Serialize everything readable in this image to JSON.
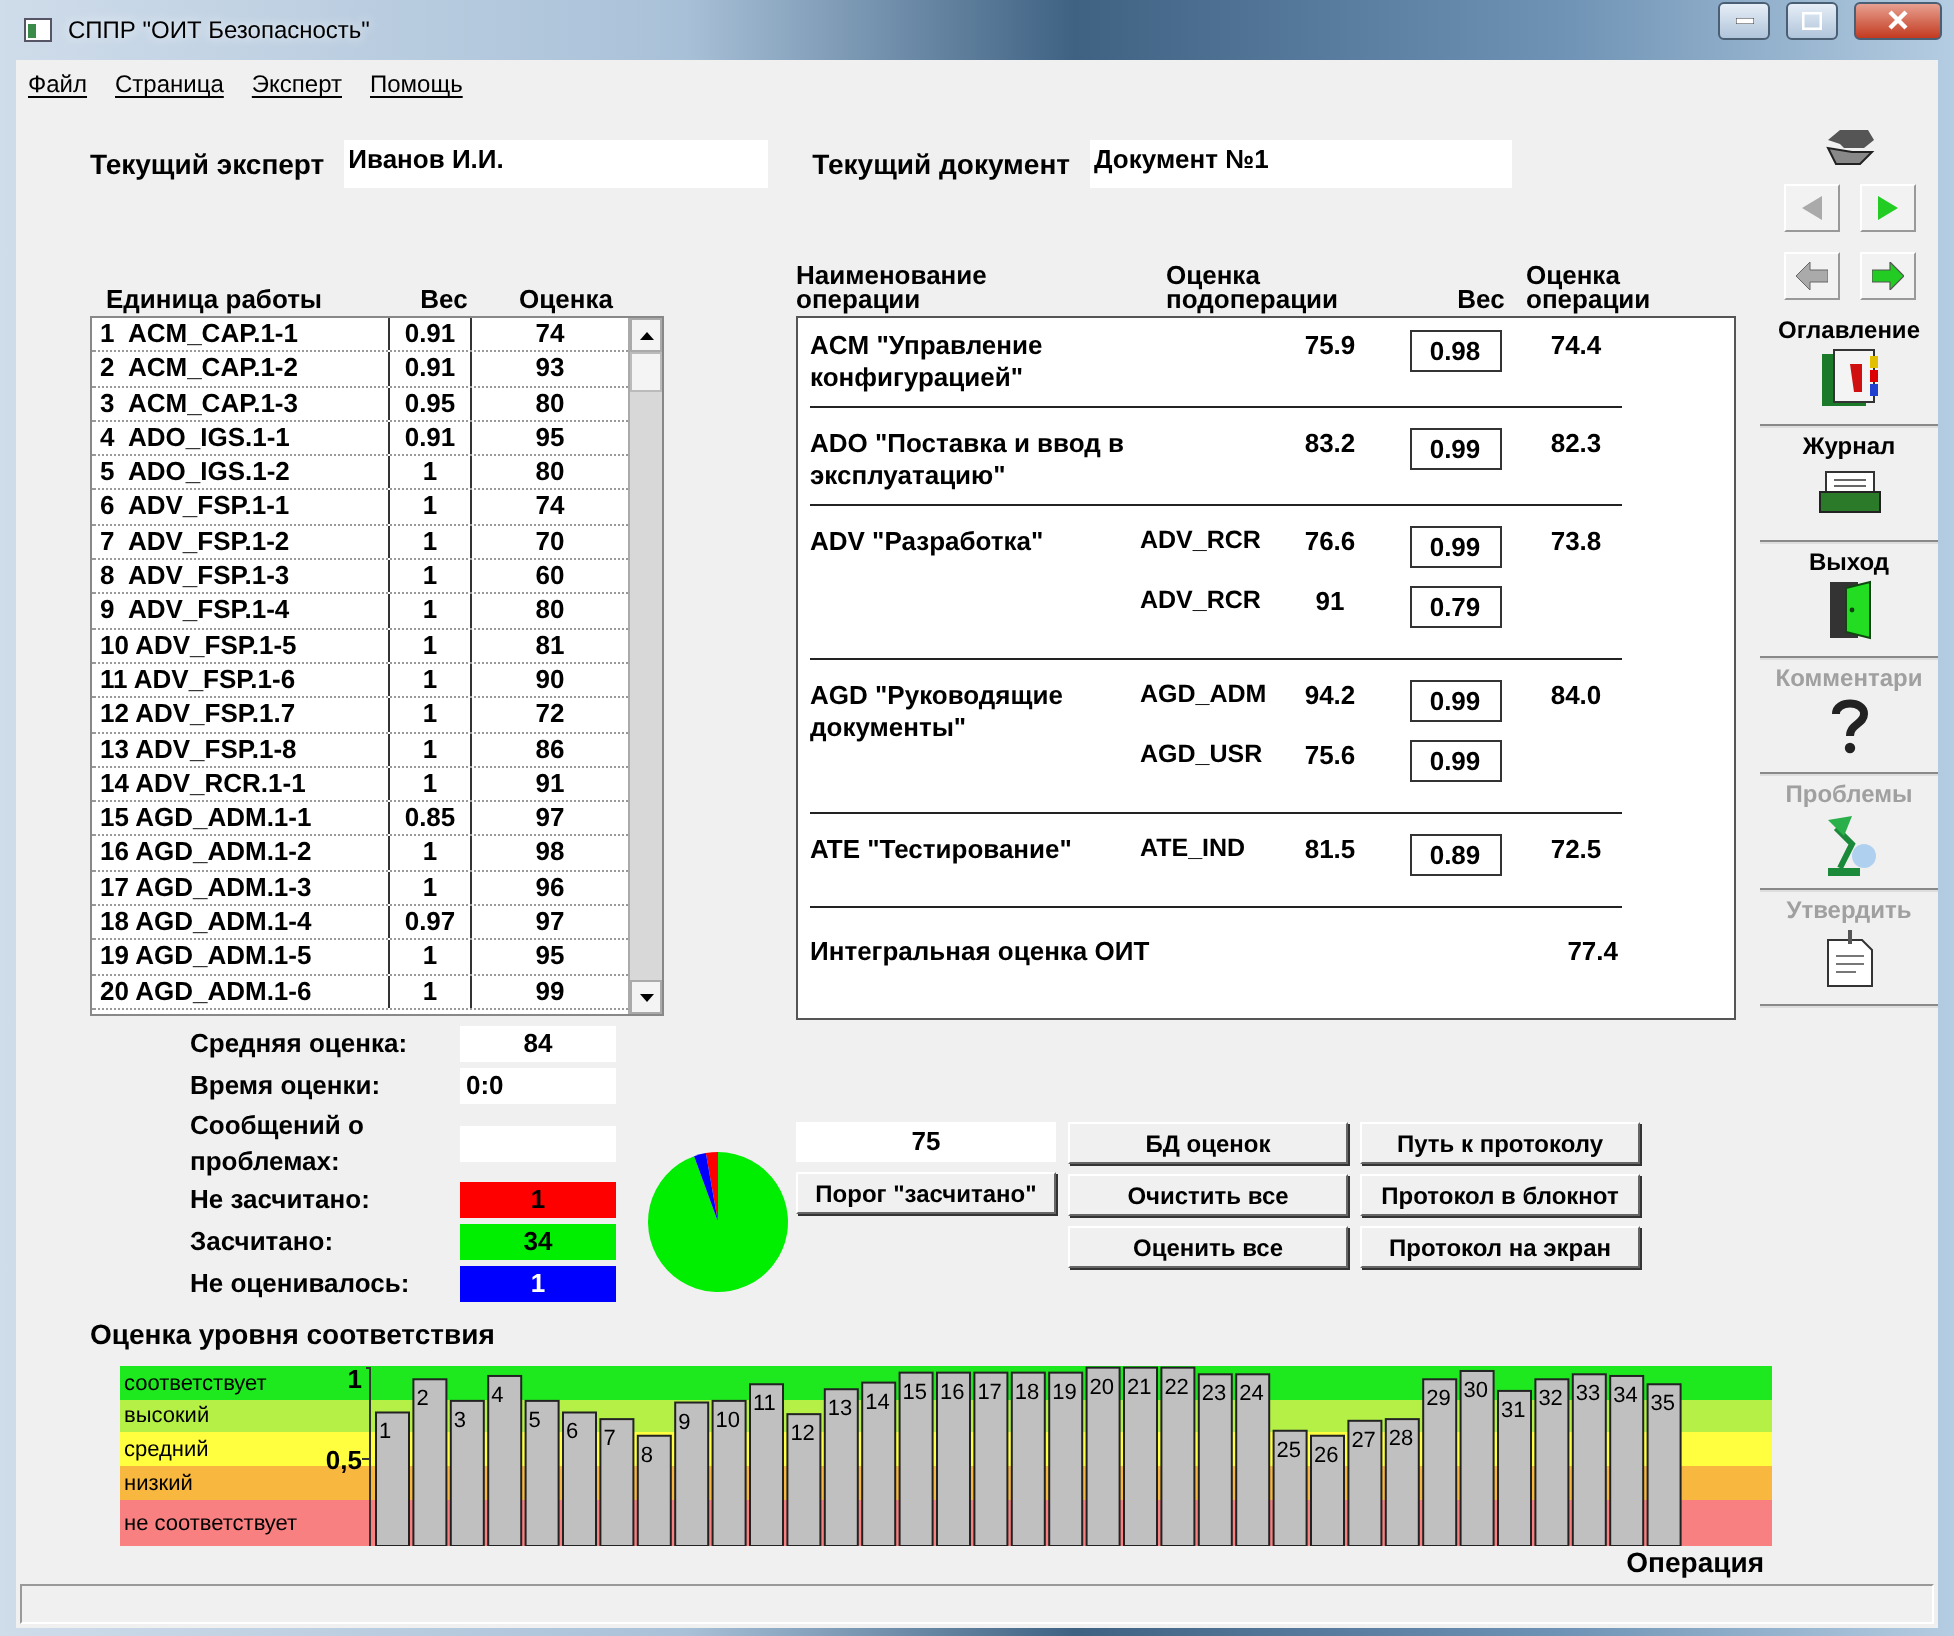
{
  "window": {
    "title": "СППР \"ОИТ Безопасность\""
  },
  "menu": [
    {
      "label": "Файл"
    },
    {
      "label": "Страница"
    },
    {
      "label": "Эксперт"
    },
    {
      "label": "Помощь"
    }
  ],
  "expert": {
    "label": "Текущий эксперт",
    "value": "Иванов И.И."
  },
  "document": {
    "label": "Текущий документ",
    "value": "Документ №1"
  },
  "units_table": {
    "columns": [
      "Единица работы",
      "Вес",
      "Оценка"
    ],
    "rows": [
      {
        "unit": "1  ACM_CAP.1-1",
        "weight": "0.91",
        "score": "74"
      },
      {
        "unit": "2  ACM_CAP.1-2",
        "weight": "0.91",
        "score": "93"
      },
      {
        "unit": "3  ACM_CAP.1-3",
        "weight": "0.95",
        "score": "80"
      },
      {
        "unit": "4  ADO_IGS.1-1",
        "weight": "0.91",
        "score": "95"
      },
      {
        "unit": "5  ADO_IGS.1-2",
        "weight": "1",
        "score": "80"
      },
      {
        "unit": "6  ADV_FSP.1-1",
        "weight": "1",
        "score": "74"
      },
      {
        "unit": "7  ADV_FSP.1-2",
        "weight": "1",
        "score": "70"
      },
      {
        "unit": "8  ADV_FSP.1-3",
        "weight": "1",
        "score": "60"
      },
      {
        "unit": "9  ADV_FSP.1-4",
        "weight": "1",
        "score": "80"
      },
      {
        "unit": "10 ADV_FSP.1-5",
        "weight": "1",
        "score": "81"
      },
      {
        "unit": "11 ADV_FSP.1-6",
        "weight": "1",
        "score": "90"
      },
      {
        "unit": "12 ADV_FSP.1.7",
        "weight": "1",
        "score": "72"
      },
      {
        "unit": "13 ADV_FSP.1-8",
        "weight": "1",
        "score": "86"
      },
      {
        "unit": "14 ADV_RCR.1-1",
        "weight": "1",
        "score": "91"
      },
      {
        "unit": "15 AGD_ADM.1-1",
        "weight": "0.85",
        "score": "97"
      },
      {
        "unit": "16 AGD_ADM.1-2",
        "weight": "1",
        "score": "98"
      },
      {
        "unit": "17 AGD_ADM.1-3",
        "weight": "1",
        "score": "96"
      },
      {
        "unit": "18 AGD_ADM.1-4",
        "weight": "0.97",
        "score": "97"
      },
      {
        "unit": "19 AGD_ADM.1-5",
        "weight": "1",
        "score": "95"
      },
      {
        "unit": "20 AGD_ADM.1-6",
        "weight": "1",
        "score": "99"
      }
    ]
  },
  "operations": {
    "columns": [
      "Наименование операции",
      "Оценка подоперации",
      "Вес",
      "Оценка операции"
    ],
    "groups": [
      {
        "name": "ACM \"Управление конфигурацией\"",
        "result": "74.4",
        "subs": [
          {
            "score": "75.9",
            "weight": "0.98"
          }
        ]
      },
      {
        "name": "ADO \"Поставка и ввод в эксплуатацию\"",
        "result": "82.3",
        "subs": [
          {
            "score": "83.2",
            "weight": "0.99"
          }
        ]
      },
      {
        "name": "ADV \"Разработка\"",
        "result": "73.8",
        "subs": [
          {
            "code": "ADV_RCR",
            "score": "76.6",
            "weight": "0.99"
          },
          {
            "code": "ADV_RCR",
            "score": "91",
            "weight": "0.79"
          }
        ]
      },
      {
        "name": "AGD \"Руководящие документы\"",
        "result": "84.0",
        "subs": [
          {
            "code": "AGD_ADM",
            "score": "94.2",
            "weight": "0.99"
          },
          {
            "code": "AGD_USR",
            "score": "75.6",
            "weight": "0.99"
          }
        ]
      },
      {
        "name": "ATE \"Тестирование\"",
        "result": "72.5",
        "subs": [
          {
            "code": "ATE_IND",
            "score": "81.5",
            "weight": "0.89"
          }
        ]
      }
    ],
    "total": {
      "label": "Интегральная оценка ОИТ",
      "value": "77.4"
    }
  },
  "stats": [
    {
      "label": "Средняя оценка:",
      "value": "84",
      "kind": "number"
    },
    {
      "label": "Время оценки:",
      "value": "0:0",
      "kind": "text"
    },
    {
      "label": "Сообщений о проблемах:",
      "kind": "text"
    },
    {
      "label": "Не засчитано:",
      "value": "1",
      "color": "#ff0000",
      "kind": "number"
    },
    {
      "label": "Засчитано:",
      "value": "34",
      "color": "#00ee00",
      "kind": "number"
    },
    {
      "label": "Не оценивалось:",
      "value": "1",
      "color": "#0000ff",
      "kind": "number"
    }
  ],
  "threshold": {
    "value": "75",
    "button": "Порог \"засчитано\""
  },
  "buttons_left": [
    "БД оценок",
    "Очистить все",
    "Оценить все"
  ],
  "buttons_right": [
    "Путь к протоколу",
    "Протокол в блокнот",
    "Протокол на экран"
  ],
  "sidebar": {
    "nav": [
      {
        "kind": "prev",
        "disabled": true
      },
      {
        "kind": "next",
        "disabled": false
      },
      {
        "kind": "back",
        "disabled": true
      },
      {
        "kind": "forward",
        "disabled": false
      }
    ],
    "buttons": [
      {
        "label": "Оглавление",
        "disabled": false
      },
      {
        "label": "Журнал",
        "disabled": false
      },
      {
        "label": "Выход",
        "disabled": false
      },
      {
        "label": "Комментари",
        "disabled": true
      },
      {
        "label": "Проблемы",
        "disabled": true
      },
      {
        "label": "Утвердить",
        "disabled": true
      }
    ]
  },
  "compliance": {
    "levels": [
      {
        "label": "соответствует",
        "color": "#1ee81e"
      },
      {
        "label": "высокий",
        "color": "#b4f046"
      },
      {
        "label": "средний",
        "color": "#ffff40"
      },
      {
        "label": "низкий",
        "color": "#f8b840"
      },
      {
        "label": "не соответствует",
        "color": "#f88080"
      }
    ],
    "chart_data": {
      "type": "bar",
      "title": "Оценка уровня соответствия",
      "xlabel": "Операция",
      "categories": [
        "1",
        "2",
        "3",
        "4",
        "5",
        "6",
        "7",
        "8",
        "9",
        "10",
        "11",
        "12",
        "13",
        "14",
        "15",
        "16",
        "17",
        "18",
        "19",
        "20",
        "21",
        "22",
        "23",
        "24",
        "25",
        "26",
        "27",
        "28",
        "29",
        "30",
        "31",
        "32",
        "33",
        "34",
        "35"
      ],
      "values": [
        0.78,
        0.98,
        0.85,
        1.0,
        0.85,
        0.78,
        0.74,
        0.64,
        0.84,
        0.85,
        0.95,
        0.77,
        0.92,
        0.96,
        1.02,
        1.02,
        1.02,
        1.02,
        1.02,
        1.05,
        1.05,
        1.05,
        1.01,
        1.01,
        0.67,
        0.64,
        0.73,
        0.74,
        0.98,
        1.03,
        0.91,
        0.98,
        1.01,
        1.0,
        0.95
      ],
      "ylim": [
        0,
        1.06
      ],
      "yticks": [
        {
          "value": 0.5,
          "label": "0,5"
        },
        {
          "value": 1,
          "label": "1"
        }
      ]
    }
  }
}
